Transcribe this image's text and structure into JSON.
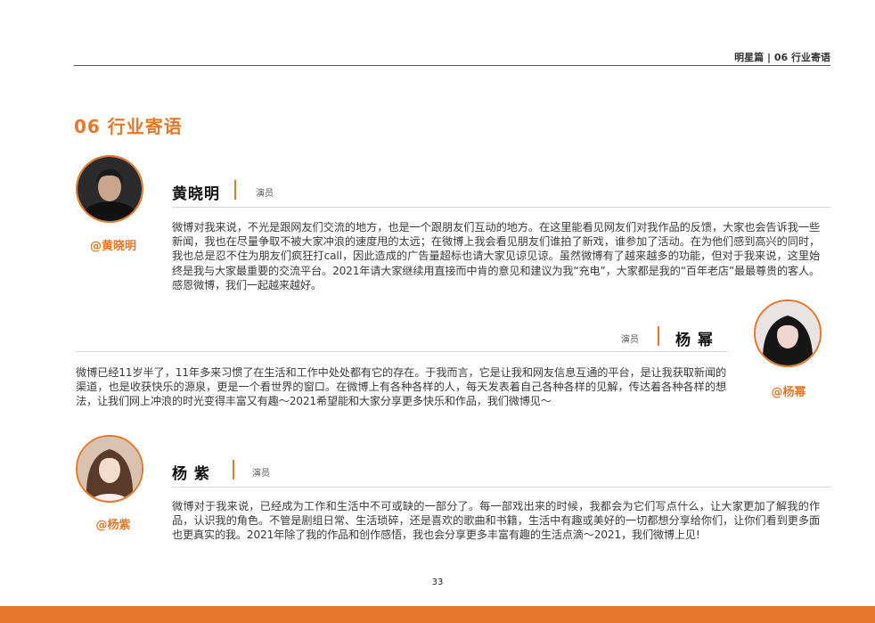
{
  "header": {
    "text": "明星篇 | 06  行业寄语"
  },
  "section": {
    "title": "06  行业寄语"
  },
  "people": [
    {
      "name": "黄晓明",
      "role": "演员",
      "handle": "@黄晓明",
      "quote": "微博对我来说，不光是跟网友们交流的地方，也是一个跟朋友们互动的地方。在这里能看见网友们对我作品的反馈，大家也会告诉我一些新闻，我也在尽量争取不被大家冲浪的速度甩的太远；在微博上我会看见朋友们谁拍了新戏，谁参加了活动。在为他们感到高兴的同时，我也总是忍不住为朋友们疯狂打call，因此造成的广告量超标也请大家见谅见谅。虽然微博有了越来越多的功能，但对于我来说，这里始终是我与大家最重要的交流平台。2021年请大家继续用直接而中肯的意见和建议为我“充电”，大家都是我的“百年老店”最最尊贵的客人。感恩微博，我们一起越来越好。"
    },
    {
      "name": "杨 幂",
      "role": "演员",
      "handle": "@杨幂",
      "quote": "微博已经11岁半了，11年多来习惯了在生活和工作中处处都有它的存在。于我而言，它是让我和网友信息互通的平台，是让我获取新闻的渠道，也是收获快乐的源泉，更是一个看世界的窗口。在微博上有各种各样的人，每天发表着自己各种各样的见解，传达着各种各样的想法，让我们网上冲浪的时光变得丰富又有趣～2021希望能和大家分享更多快乐和作品，我们微博见～"
    },
    {
      "name": "杨 紫",
      "role": "演员",
      "handle": "@杨紫",
      "quote": "微博对于我来说，已经成为工作和生活中不可或缺的一部分了。每一部戏出来的时候，我都会为它们写点什么，让大家更加了解我的作品，认识我的角色。不管是剧组日常、生活琐碎，还是喜欢的歌曲和书籍，生活中有趣或美好的一切都想分享给你们，让你们看到更多面也更真实的我。2021年除了我的作品和创作感悟，我也会分享更多丰富有趣的生活点滴～2021，我们微博上见!"
    }
  ],
  "page_number": "33",
  "colors": {
    "accent": "#e5782a",
    "text": "#3a3a3a"
  }
}
